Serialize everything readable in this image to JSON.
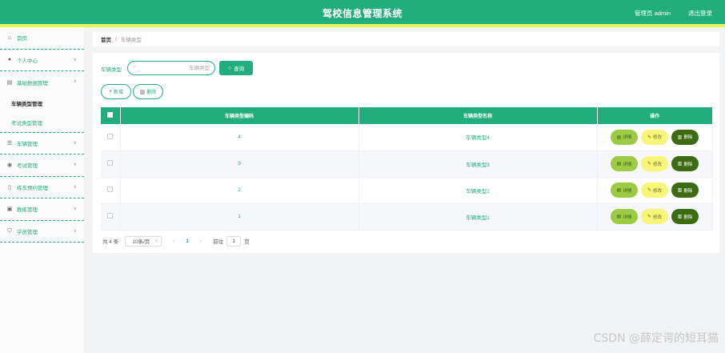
{
  "header": {
    "title": "驾校信息管理系统",
    "admin": "管理员 admin",
    "logout": "退出登录"
  },
  "sidebar": {
    "items": [
      {
        "label": "首页",
        "icon": "home-icon",
        "chevron": false
      },
      {
        "label": "个人中心",
        "icon": "user-icon",
        "chevron": true
      },
      {
        "label": "基础数据管理",
        "icon": "clipboard-icon",
        "chevron": true,
        "expanded": true,
        "children": [
          {
            "label": "车辆类型管理",
            "active": true
          },
          {
            "label": "考试类型管理",
            "active": false
          }
        ]
      },
      {
        "label": "车辆管理",
        "icon": "sliders-icon",
        "chevron": true
      },
      {
        "label": "考试管理",
        "icon": "pin-icon",
        "chevron": true
      },
      {
        "label": "练车预约管理",
        "icon": "phone-icon",
        "chevron": true
      },
      {
        "label": "教练管理",
        "icon": "board-icon",
        "chevron": true
      },
      {
        "label": "学员管理",
        "icon": "shield-icon",
        "chevron": true
      }
    ]
  },
  "breadcrumb": {
    "home": "首页",
    "separator": "/",
    "current": "车辆类型"
  },
  "search": {
    "label": "车辆类型",
    "placeholder": "车辆类型",
    "value": "",
    "button": "查询"
  },
  "actions": {
    "add": "新增",
    "delete": "删除"
  },
  "table": {
    "columns": [
      "车辆类型编码",
      "车辆类型名称",
      "操作"
    ],
    "rows": [
      {
        "code": "4",
        "name": "车辆类型4"
      },
      {
        "code": "3",
        "name": "车辆类型3"
      },
      {
        "code": "2",
        "name": "车辆类型2"
      },
      {
        "code": "1",
        "name": "车辆类型1"
      }
    ],
    "row_actions": {
      "detail": "详情",
      "edit": "修改",
      "delete": "删除"
    }
  },
  "pagination": {
    "total": "共 4 条",
    "page_size": "10条/页",
    "current_page": "1",
    "goto_prefix": "前往",
    "goto_value": "1",
    "goto_suffix": "页"
  },
  "watermark": "CSDN @薛定谔的短耳猫",
  "colors": {
    "primary": "#22ad7c",
    "accent_strip": "#e6f55a",
    "detail_btn": "#9ccb44",
    "edit_btn": "#f8f57b",
    "delete_btn": "#3d6b14"
  }
}
